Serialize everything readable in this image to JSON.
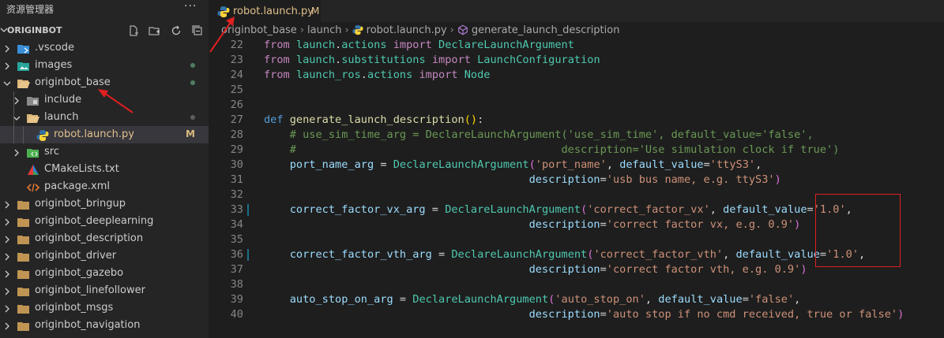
{
  "sidebar": {
    "title": "资源管理器",
    "more": "···",
    "project": "ORIGINBOT",
    "items": [
      {
        "label": ".vscode",
        "icon": "vscode-folder-icon",
        "chevron": "right",
        "depth": 0
      },
      {
        "label": "images",
        "icon": "images-folder-icon",
        "chevron": "right",
        "depth": 0,
        "status": "dot"
      },
      {
        "label": "originbot_base",
        "icon": "folder-open-icon",
        "chevron": "down",
        "depth": 0,
        "status": "dot"
      },
      {
        "label": "include",
        "icon": "include-folder-icon",
        "chevron": "right",
        "depth": 1
      },
      {
        "label": "launch",
        "icon": "folder-open-icon",
        "chevron": "down",
        "depth": 1,
        "status": "dot"
      },
      {
        "label": "robot.launch.py",
        "icon": "python-icon",
        "depth": 2,
        "status": "M",
        "selected": true
      },
      {
        "label": "src",
        "icon": "src-folder-icon",
        "chevron": "right",
        "depth": 1
      },
      {
        "label": "CMakeLists.txt",
        "icon": "cmake-icon",
        "depth": 1
      },
      {
        "label": "package.xml",
        "icon": "xml-icon",
        "depth": 1
      },
      {
        "label": "originbot_bringup",
        "icon": "folder-icon",
        "chevron": "right",
        "depth": 0
      },
      {
        "label": "originbot_deeplearning",
        "icon": "folder-icon",
        "chevron": "right",
        "depth": 0
      },
      {
        "label": "originbot_description",
        "icon": "folder-icon",
        "chevron": "right",
        "depth": 0
      },
      {
        "label": "originbot_driver",
        "icon": "folder-icon",
        "chevron": "right",
        "depth": 0
      },
      {
        "label": "originbot_gazebo",
        "icon": "folder-icon",
        "chevron": "right",
        "depth": 0
      },
      {
        "label": "originbot_linefollower",
        "icon": "folder-icon",
        "chevron": "right",
        "depth": 0
      },
      {
        "label": "originbot_msgs",
        "icon": "folder-icon",
        "chevron": "right",
        "depth": 0
      },
      {
        "label": "originbot_navigation",
        "icon": "folder-icon",
        "chevron": "right",
        "depth": 0
      }
    ]
  },
  "tab": {
    "label": "robot.launch.py",
    "modified": "M"
  },
  "breadcrumb": [
    "originbot_base",
    "launch",
    "robot.launch.py",
    "generate_launch_description"
  ],
  "code": [
    {
      "n": "22",
      "tokens": [
        [
          "kw",
          "from"
        ],
        [
          "t",
          " "
        ],
        [
          "mod",
          "launch"
        ],
        [
          "t",
          "."
        ],
        [
          "mod",
          "actions"
        ],
        [
          "t",
          " "
        ],
        [
          "kw",
          "import"
        ],
        [
          "t",
          " "
        ],
        [
          "mod",
          "DeclareLaunchArgument"
        ]
      ]
    },
    {
      "n": "23",
      "tokens": [
        [
          "kw",
          "from"
        ],
        [
          "t",
          " "
        ],
        [
          "mod",
          "launch"
        ],
        [
          "t",
          "."
        ],
        [
          "mod",
          "substitutions"
        ],
        [
          "t",
          " "
        ],
        [
          "kw",
          "import"
        ],
        [
          "t",
          " "
        ],
        [
          "mod",
          "LaunchConfiguration"
        ]
      ]
    },
    {
      "n": "24",
      "tokens": [
        [
          "kw",
          "from"
        ],
        [
          "t",
          " "
        ],
        [
          "mod",
          "launch_ros"
        ],
        [
          "t",
          "."
        ],
        [
          "mod",
          "actions"
        ],
        [
          "t",
          " "
        ],
        [
          "kw",
          "import"
        ],
        [
          "t",
          " "
        ],
        [
          "mod",
          "Node"
        ]
      ]
    },
    {
      "n": "25",
      "tokens": []
    },
    {
      "n": "26",
      "tokens": []
    },
    {
      "n": "27",
      "tokens": [
        [
          "kd",
          "def"
        ],
        [
          "t",
          " "
        ],
        [
          "fn",
          "generate_launch_description"
        ],
        [
          "br",
          "()"
        ],
        [
          "t",
          ":"
        ]
      ]
    },
    {
      "n": "28",
      "tokens": [
        [
          "t",
          "    "
        ],
        [
          "cm",
          "# use_sim_time_arg = DeclareLaunchArgument('use_sim_time', default_value='false',"
        ]
      ]
    },
    {
      "n": "29",
      "tokens": [
        [
          "t",
          "    "
        ],
        [
          "cm",
          "#                                         description='Use simulation clock if true')"
        ]
      ]
    },
    {
      "n": "30",
      "tokens": [
        [
          "t",
          "    "
        ],
        [
          "var",
          "port_name_arg"
        ],
        [
          "t",
          " = "
        ],
        [
          "mod",
          "DeclareLaunchArgument"
        ],
        [
          "br2",
          "("
        ],
        [
          "str",
          "'port_name'"
        ],
        [
          "t",
          ", "
        ],
        [
          "var",
          "default_value"
        ],
        [
          "t",
          "="
        ],
        [
          "str",
          "'ttyS3'"
        ],
        [
          "t",
          ","
        ]
      ]
    },
    {
      "n": "31",
      "tokens": [
        [
          "t",
          "                                         "
        ],
        [
          "var",
          "description"
        ],
        [
          "t",
          "="
        ],
        [
          "str",
          "'usb bus name, e.g. ttyS3'"
        ],
        [
          "br2",
          ")"
        ]
      ]
    },
    {
      "n": "32",
      "tokens": []
    },
    {
      "n": "33",
      "tokens": [
        [
          "t",
          "    "
        ],
        [
          "var",
          "correct_factor_vx_arg"
        ],
        [
          "t",
          " = "
        ],
        [
          "mod",
          "DeclareLaunchArgument"
        ],
        [
          "br2",
          "("
        ],
        [
          "str",
          "'correct_factor_vx'"
        ],
        [
          "t",
          ", "
        ],
        [
          "var",
          "default_value"
        ],
        [
          "t",
          "="
        ],
        [
          "str",
          "'1.0'"
        ],
        [
          "t",
          ","
        ]
      ],
      "mark": true
    },
    {
      "n": "34",
      "tokens": [
        [
          "t",
          "                                         "
        ],
        [
          "var",
          "description"
        ],
        [
          "t",
          "="
        ],
        [
          "str",
          "'correct factor vx, e.g. 0.9'"
        ],
        [
          "br2",
          ")"
        ]
      ]
    },
    {
      "n": "35",
      "tokens": []
    },
    {
      "n": "36",
      "tokens": [
        [
          "t",
          "    "
        ],
        [
          "var",
          "correct_factor_vth_arg"
        ],
        [
          "t",
          " = "
        ],
        [
          "mod",
          "DeclareLaunchArgument"
        ],
        [
          "br2",
          "("
        ],
        [
          "str",
          "'correct_factor_vth'"
        ],
        [
          "t",
          ", "
        ],
        [
          "var",
          "default_value"
        ],
        [
          "t",
          "="
        ],
        [
          "str",
          "'1.0'"
        ],
        [
          "t",
          ","
        ]
      ],
      "mark": true
    },
    {
      "n": "37",
      "tokens": [
        [
          "t",
          "                                         "
        ],
        [
          "var",
          "description"
        ],
        [
          "t",
          "="
        ],
        [
          "str",
          "'correct factor vth, e.g. 0.9'"
        ],
        [
          "br2",
          ")"
        ]
      ]
    },
    {
      "n": "38",
      "tokens": []
    },
    {
      "n": "39",
      "tokens": [
        [
          "t",
          "    "
        ],
        [
          "var",
          "auto_stop_on_arg"
        ],
        [
          "t",
          " = "
        ],
        [
          "mod",
          "DeclareLaunchArgument"
        ],
        [
          "br2",
          "("
        ],
        [
          "str",
          "'auto_stop_on'"
        ],
        [
          "t",
          ", "
        ],
        [
          "var",
          "default_value"
        ],
        [
          "t",
          "="
        ],
        [
          "str",
          "'false'"
        ],
        [
          "t",
          ","
        ]
      ]
    },
    {
      "n": "40",
      "tokens": [
        [
          "t",
          "                                         "
        ],
        [
          "var",
          "description"
        ],
        [
          "t",
          "="
        ],
        [
          "str",
          "'auto stop if no cmd received, true or false'"
        ],
        [
          "br2",
          ")"
        ]
      ]
    }
  ],
  "colors": {
    "accent": "#e02020",
    "modified": "#e2c08d",
    "python": "#3572A5"
  }
}
